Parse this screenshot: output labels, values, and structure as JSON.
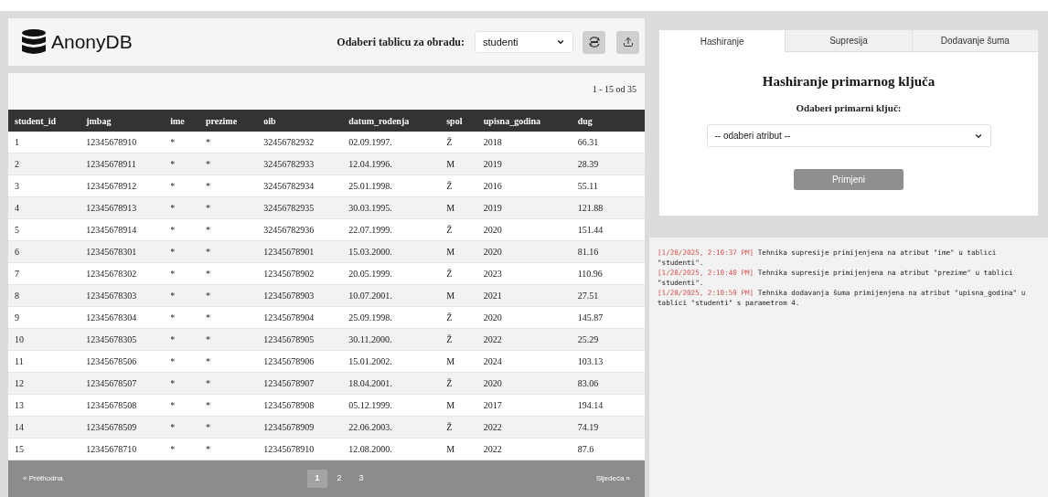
{
  "header": {
    "logo": "AnonyDB",
    "table_label": "Odaberi tablicu za obradu:",
    "table_value": "studenti"
  },
  "table": {
    "range": "1 - 15 od 35",
    "columns": [
      "student_id",
      "jmbag",
      "ime",
      "prezime",
      "oib",
      "datum_rodenja",
      "spol",
      "upisna_godina",
      "dug"
    ],
    "rows": [
      [
        "1",
        "12345678910",
        "*",
        "*",
        "32456782932",
        "02.09.1997.",
        "Ž",
        "2018",
        "66.31"
      ],
      [
        "2",
        "12345678911",
        "*",
        "*",
        "32456782933",
        "12.04.1996.",
        "M",
        "2019",
        "28.39"
      ],
      [
        "3",
        "12345678912",
        "*",
        "*",
        "32456782934",
        "25.01.1998.",
        "Ž",
        "2016",
        "55.11"
      ],
      [
        "4",
        "12345678913",
        "*",
        "*",
        "32456782935",
        "30.03.1995.",
        "M",
        "2019",
        "121.88"
      ],
      [
        "5",
        "12345678914",
        "*",
        "*",
        "32456782936",
        "22.07.1999.",
        "Ž",
        "2020",
        "151.44"
      ],
      [
        "6",
        "12345678301",
        "*",
        "*",
        "12345678901",
        "15.03.2000.",
        "M",
        "2020",
        "81.16"
      ],
      [
        "7",
        "12345678302",
        "*",
        "*",
        "12345678902",
        "20.05.1999.",
        "Ž",
        "2023",
        "110.96"
      ],
      [
        "8",
        "12345678303",
        "*",
        "*",
        "12345678903",
        "10.07.2001.",
        "M",
        "2021",
        "27.51"
      ],
      [
        "9",
        "12345678304",
        "*",
        "*",
        "12345678904",
        "25.09.1998.",
        "Ž",
        "2020",
        "145.87"
      ],
      [
        "10",
        "12345678305",
        "*",
        "*",
        "12345678905",
        "30.11.2000.",
        "Ž",
        "2022",
        "25.29"
      ],
      [
        "11",
        "12345678506",
        "*",
        "*",
        "12345678906",
        "15.01.2002.",
        "M",
        "2024",
        "103.13"
      ],
      [
        "12",
        "12345678507",
        "*",
        "*",
        "12345678907",
        "18.04.2001.",
        "Ž",
        "2020",
        "83.06"
      ],
      [
        "13",
        "12345678508",
        "*",
        "*",
        "12345678908",
        "05.12.1999.",
        "M",
        "2017",
        "194.14"
      ],
      [
        "14",
        "12345678509",
        "*",
        "*",
        "12345678909",
        "22.06.2003.",
        "Ž",
        "2022",
        "74.19"
      ],
      [
        "15",
        "12345678710",
        "*",
        "*",
        "12345678910",
        "12.08.2000.",
        "M",
        "2022",
        "87.6"
      ]
    ]
  },
  "pagination": {
    "prev": "« Prethodna",
    "next": "Sljedeća »",
    "pages": [
      {
        "label": "1",
        "selected": true
      },
      {
        "label": "2",
        "selected": false
      },
      {
        "label": "3",
        "selected": false
      }
    ]
  },
  "tabs": [
    {
      "label": "Hashiranje",
      "selected": true
    },
    {
      "label": "Supresija",
      "selected": false
    },
    {
      "label": "Dodavanje šuma",
      "selected": false
    }
  ],
  "panel": {
    "title": "Hashiranje primarnog ključa",
    "label": "Odaberi primarni ključ:",
    "select_value": "-- odaberi atribut --",
    "apply": "Primjeni",
    "apply_disabled": true
  },
  "log": [
    {
      "time": "[1/28/2025, 2:10:37 PM]",
      "message": "Tehnika supresije primijenjena na atribut \"ime\" u tablici \"studenti\"."
    },
    {
      "time": "[1/28/2025, 2:10:40 PM]",
      "message": "Tehnika supresije primijenjena na atribut \"prezime\" u tablici \"studenti\"."
    },
    {
      "time": "[1/28/2025, 2:10:59 PM]",
      "message": "Tehnika dodavanja šuma primijenjena na atribut \"upisna_godina\" u tablici \"studenti\" s parametrom 4."
    }
  ]
}
